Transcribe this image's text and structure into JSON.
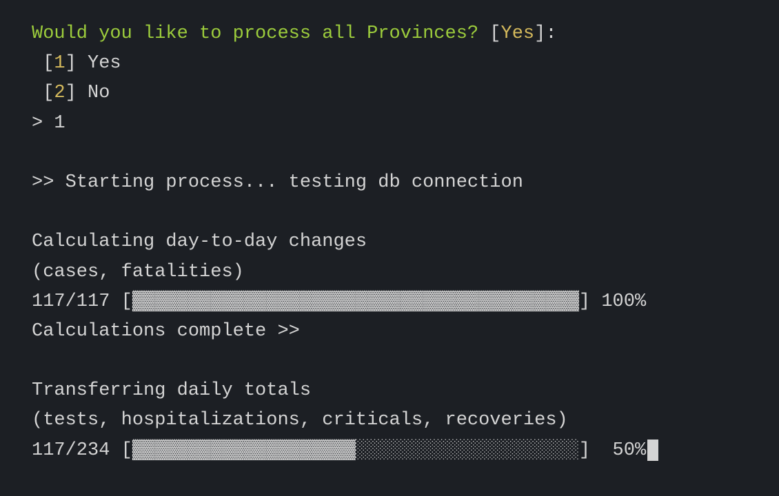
{
  "prompt": {
    "question": "Would you like to process all Provinces?",
    "default_value": "Yes",
    "open_bracket": " [",
    "close_bracket": "]",
    "colon": ":"
  },
  "options": [
    {
      "prefix": " [",
      "num": "1",
      "suffix": "] ",
      "label": "Yes"
    },
    {
      "prefix": " [",
      "num": "2",
      "suffix": "] ",
      "label": "No"
    }
  ],
  "input": {
    "prompt_symbol": "> ",
    "value": "1"
  },
  "status": {
    "starting": ">> Starting process... testing db connection"
  },
  "task1": {
    "title": "Calculating day-to-day changes",
    "subtitle": "(cases, fatalities)",
    "progress_count": "117/117 ",
    "progress_bar": "[▓▓▓▓▓▓▓▓▓▓▓▓▓▓▓▓▓▓▓▓▓▓▓▓▓▓▓▓▓▓▓▓▓▓▓▓▓▓▓▓] 100%",
    "complete": "Calculations complete >>"
  },
  "task2": {
    "title": "Transferring daily totals",
    "subtitle": "(tests, hospitalizations, criticals, recoveries)",
    "progress_count": "117/234 ",
    "progress_bar": "[▓▓▓▓▓▓▓▓▓▓▓▓▓▓▓▓▓▓▓▓░░░░░░░░░░░░░░░░░░░░]  50%"
  }
}
